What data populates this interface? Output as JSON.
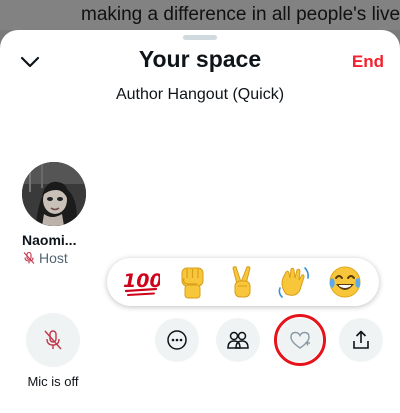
{
  "background": {
    "line_partial": "",
    "line": "making a difference in all people's lives."
  },
  "header": {
    "title": "Your space",
    "end_label": "End"
  },
  "space": {
    "subtitle": "Author Hangout (Quick)"
  },
  "speaker": {
    "name": "Naomi...",
    "role": "Host"
  },
  "reactions": [
    {
      "name": "hundred-points",
      "glyph": "💯"
    },
    {
      "name": "raised-fist",
      "glyph": "✊"
    },
    {
      "name": "victory-hand",
      "glyph": "✌️"
    },
    {
      "name": "waving-hand",
      "glyph": "👋"
    },
    {
      "name": "tears-of-joy",
      "glyph": "😂"
    }
  ],
  "controls": {
    "mic_label": "Mic is off"
  },
  "colors": {
    "accent_red": "#f4212e",
    "highlight_ring": "#e5141b",
    "button_bg": "#eff3f4",
    "muted_text": "#536471"
  }
}
